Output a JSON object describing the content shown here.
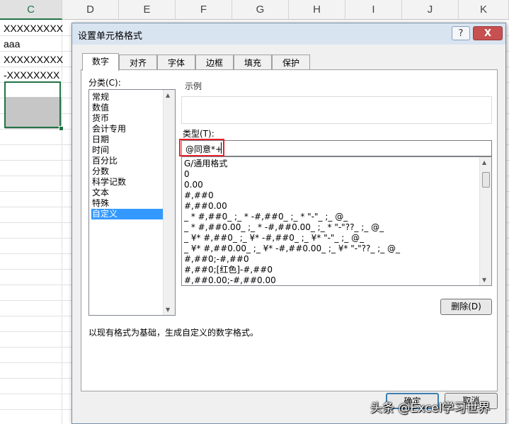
{
  "sheet": {
    "columns": [
      "C",
      "D",
      "E",
      "F",
      "G",
      "H",
      "I",
      "J",
      "K"
    ],
    "cells": [
      "XXXXXXXXX",
      "aaa",
      "XXXXXXXXX",
      "-XXXXXXXX"
    ]
  },
  "dialog": {
    "title": "设置单元格格式",
    "help_btn": "?",
    "close_btn": "X",
    "tabs": [
      "数字",
      "对齐",
      "字体",
      "边框",
      "填充",
      "保护"
    ],
    "category_label": "分类(C):",
    "categories": [
      "常规",
      "数值",
      "货币",
      "会计专用",
      "日期",
      "时间",
      "百分比",
      "分数",
      "科学记数",
      "文本",
      "特殊",
      "自定义"
    ],
    "selected_category": "自定义",
    "sample_label": "示例",
    "type_label": "类型(T):",
    "type_value": "@同意*+",
    "formats": [
      "G/通用格式",
      "0",
      "0.00",
      "#,##0",
      "#,##0.00",
      "_ * #,##0_ ;_ * -#,##0_ ;_ * \"-\"_ ;_ @_",
      "_ * #,##0.00_ ;_ * -#,##0.00_ ;_ * \"-\"??_ ;_ @_",
      "_ ¥* #,##0_ ;_ ¥* -#,##0_ ;_ ¥* \"-\"_ ;_ @_",
      "_ ¥* #,##0.00_ ;_ ¥* -#,##0.00_ ;_ ¥* \"-\"??_ ;_ @_",
      "#,##0;-#,##0",
      "#,##0;[红色]-#,##0",
      "#,##0.00;-#,##0.00"
    ],
    "delete_btn": "删除(D)",
    "description": "以现有格式为基础，生成自定义的数字格式。",
    "ok_btn": "确定",
    "cancel_btn": "取消"
  },
  "watermark": "头条 @Excel学习世界",
  "icons": {
    "scroll_up": "triangle-up",
    "scroll_down": "triangle-down"
  },
  "colors": {
    "selection": "#217346",
    "highlight": "#3399ff",
    "red_annotation": "#e8212c"
  }
}
